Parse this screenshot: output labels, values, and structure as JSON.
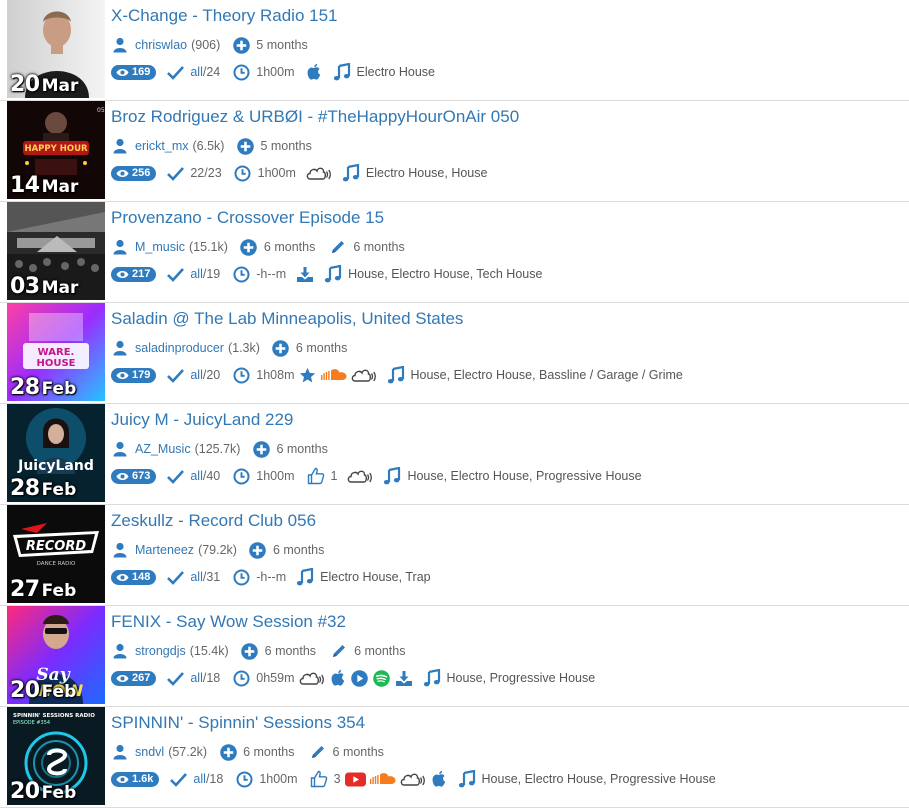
{
  "colors": {
    "accent": "#3278b4",
    "badge": "#2f7bbf",
    "soundcloud": "#f57c1f",
    "youtube": "#e52d27",
    "spotify": "#1db954"
  },
  "items": [
    {
      "title": "X-Change - Theory Radio 151",
      "date_day": "20",
      "date_month": "Mar",
      "user": "chriswlao",
      "user_count": "(906)",
      "added": "5 months",
      "edited": null,
      "views": "169",
      "tracks_ided": "all",
      "tracks_total": "/24",
      "duration": "1h00m",
      "likes": null,
      "sources": [
        "apple-icon"
      ],
      "genres": "Electro House"
    },
    {
      "title": "Broz Rodriguez & URBØI - #TheHappyHourOnAir 050",
      "date_day": "14",
      "date_month": "Mar",
      "user": "erickt_mx",
      "user_count": "(6.5k)",
      "added": "5 months",
      "edited": null,
      "views": "256",
      "tracks_ided": "22/23",
      "tracks_total": "",
      "duration": "1h00m",
      "likes": null,
      "sources": [
        "cloud-stream-icon"
      ],
      "genres": "Electro House, House"
    },
    {
      "title": "Provenzano - Crossover Episode 15",
      "date_day": "03",
      "date_month": "Mar",
      "user": "M_music",
      "user_count": "(15.1k)",
      "added": "6 months",
      "edited": "6 months",
      "views": "217",
      "tracks_ided": "all",
      "tracks_total": "/19",
      "duration": "-h--m",
      "likes": null,
      "sources": [
        "download-icon"
      ],
      "genres": "House, Electro House, Tech House"
    },
    {
      "title": "Saladin @ The Lab Minneapolis, United States",
      "date_day": "28",
      "date_month": "Feb",
      "user": "saladinproducer",
      "user_count": "(1.3k)",
      "added": "6 months",
      "edited": null,
      "views": "179",
      "tracks_ided": "all",
      "tracks_total": "/20",
      "duration": "1h08m",
      "likes": null,
      "sources": [
        "star-icon",
        "soundcloud-icon",
        "cloud-stream-icon"
      ],
      "genres": "House, Electro House, Bassline / Garage / Grime"
    },
    {
      "title": "Juicy M - JuicyLand 229",
      "date_day": "28",
      "date_month": "Feb",
      "user": "AZ_Music",
      "user_count": "(125.7k)",
      "added": "6 months",
      "edited": null,
      "views": "673",
      "tracks_ided": "all",
      "tracks_total": "/40",
      "duration": "1h00m",
      "likes": "1",
      "sources": [
        "cloud-stream-icon"
      ],
      "genres": "House, Electro House, Progressive House"
    },
    {
      "title": "Zeskullz - Record Club 056",
      "date_day": "27",
      "date_month": "Feb",
      "user": "Marteneez",
      "user_count": "(79.2k)",
      "added": "6 months",
      "edited": null,
      "views": "148",
      "tracks_ided": "all",
      "tracks_total": "/31",
      "duration": "-h--m",
      "likes": null,
      "sources": [],
      "genres": "Electro House, Trap"
    },
    {
      "title": "FENIX - Say Wow Session #32",
      "date_day": "20",
      "date_month": "Feb",
      "user": "strongdjs",
      "user_count": "(15.4k)",
      "added": "6 months",
      "edited": "6 months",
      "views": "267",
      "tracks_ided": "all",
      "tracks_total": "/18",
      "duration": "0h59m",
      "likes": null,
      "sources": [
        "cloud-stream-icon",
        "apple-icon",
        "play-icon",
        "spotify-icon",
        "download-icon"
      ],
      "genres": "House, Progressive House"
    },
    {
      "title": "SPINNIN' - Spinnin' Sessions 354",
      "date_day": "20",
      "date_month": "Feb",
      "user": "sndvl",
      "user_count": "(57.2k)",
      "added": "6 months",
      "edited": "6 months",
      "views": "1.6k",
      "tracks_ided": "all",
      "tracks_total": "/18",
      "duration": "1h00m",
      "likes": "3",
      "sources": [
        "youtube-icon",
        "soundcloud-icon",
        "cloud-stream-icon",
        "apple-icon"
      ],
      "genres": "House, Electro House, Progressive House"
    }
  ],
  "thumbnails": [
    {
      "art": "portrait-dark-shirt",
      "caption": ""
    },
    {
      "art": "happy-hour-poster",
      "caption": "HAPPY HOUR"
    },
    {
      "art": "stage-crowd-bw",
      "caption": ""
    },
    {
      "art": "warehouse-poster",
      "caption": "WARE HOUSE"
    },
    {
      "art": "juicyland-poster",
      "caption": "JuicyLand"
    },
    {
      "art": "record-radio-logo",
      "caption": "RECORD"
    },
    {
      "art": "say-wow-poster",
      "caption": "Say WOW"
    },
    {
      "art": "spinnin-sessions-logo",
      "caption": "SPINNIN' SESSIONS RADIO"
    }
  ]
}
